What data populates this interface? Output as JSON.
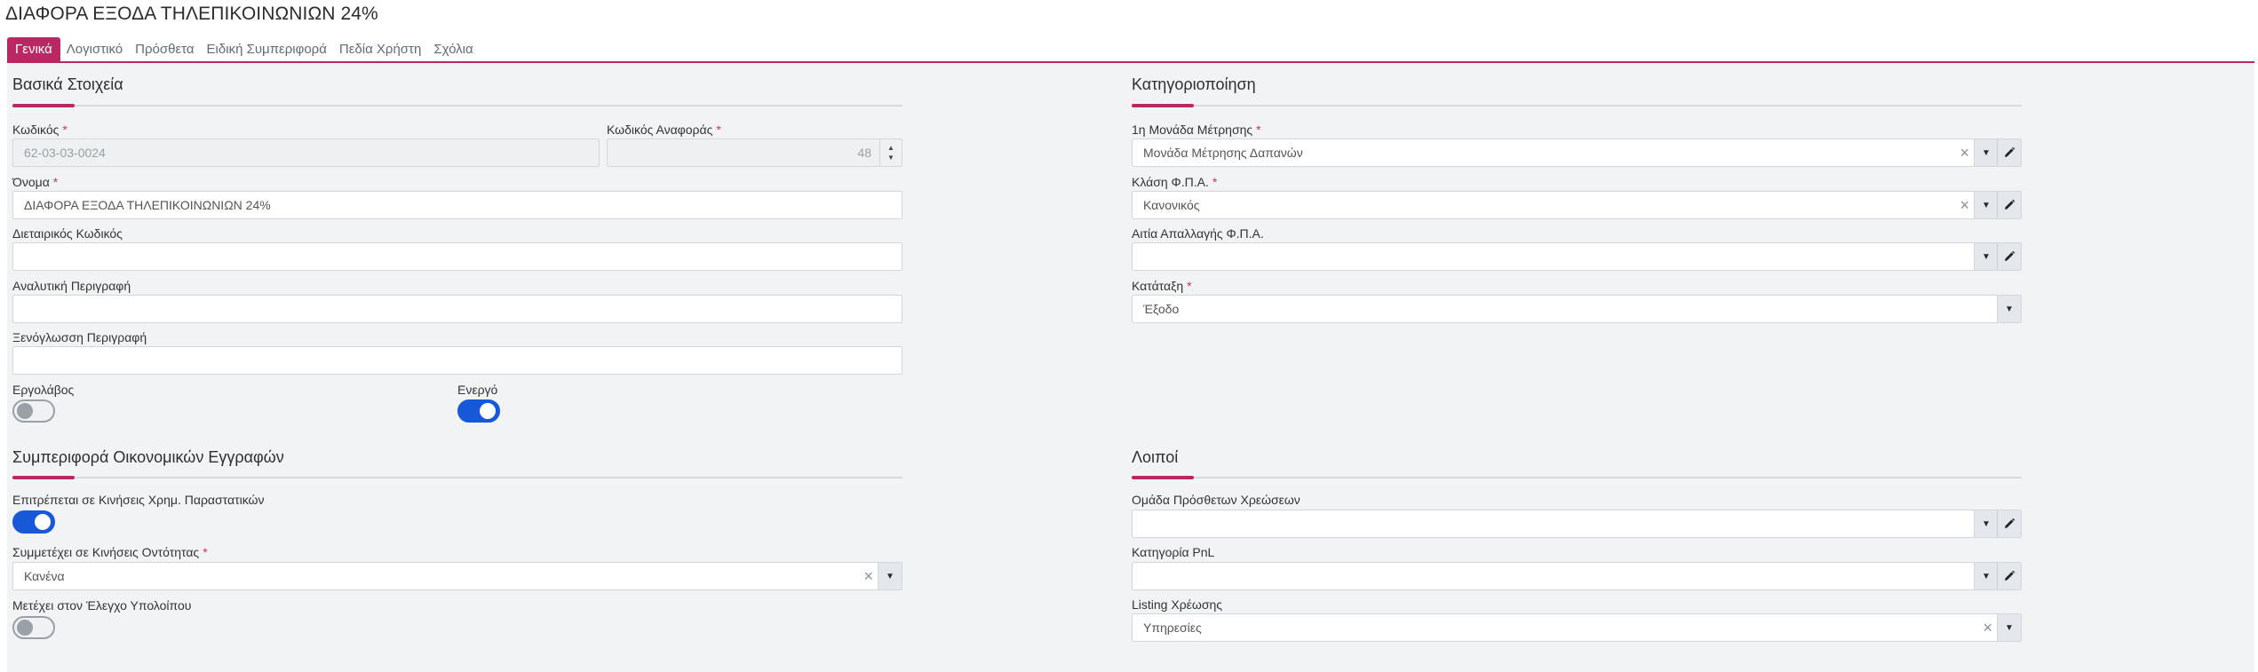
{
  "page": {
    "title": "ΔΙΑΦΟΡΑ ΕΞΟΔΑ ΤΗΛΕΠΙΚΟΙΝΩΝΙΩΝ 24%"
  },
  "tabs": [
    {
      "label": "Γενικά",
      "active": true
    },
    {
      "label": "Λογιστικό",
      "active": false
    },
    {
      "label": "Πρόσθετα",
      "active": false
    },
    {
      "label": "Ειδική Συμπεριφορά",
      "active": false
    },
    {
      "label": "Πεδία Χρήστη",
      "active": false
    },
    {
      "label": "Σχόλια",
      "active": false
    }
  ],
  "colors": {
    "accent": "#b92862",
    "toggle_on": "#1658d8",
    "required": "#d0344d",
    "panel_bg": "#f2f3f5"
  },
  "basic": {
    "title": "Βασικά Στοιχεία",
    "code": {
      "label": "Κωδικός",
      "value": "62-03-03-0024",
      "required": true,
      "disabled": true
    },
    "ref_code": {
      "label": "Κωδικός Αναφοράς",
      "value": "48",
      "required": true,
      "disabled": true
    },
    "name": {
      "label": "Όνομα",
      "value": "ΔΙΑΦΟΡΑ ΕΞΟΔΑ ΤΗΛΕΠΙΚΟΙΝΩΝΙΩΝ 24%",
      "required": true
    },
    "intl_code": {
      "label": "Διεταιρικός Κωδικός",
      "value": ""
    },
    "description": {
      "label": "Αναλυτική Περιγραφή",
      "value": ""
    },
    "foreign_description": {
      "label": "Ξενόγλωσση Περιγραφή",
      "value": ""
    },
    "contractor": {
      "label": "Εργολάβος",
      "on": false
    },
    "active": {
      "label": "Ενεργό",
      "on": true
    }
  },
  "classification": {
    "title": "Κατηγοριοποίηση",
    "unit": {
      "label": "1η Μονάδα Μέτρησης",
      "value": "Μονάδα Μέτρησης Δαπανών",
      "required": true
    },
    "vat_class": {
      "label": "Κλάση Φ.Π.Α.",
      "value": "Κανονικός",
      "required": true
    },
    "vat_exemption": {
      "label": "Αιτία Απαλλαγής Φ.Π.Α.",
      "value": ""
    },
    "category": {
      "label": "Κατάταξη",
      "value": "Έξοδο",
      "required": true
    }
  },
  "financial": {
    "title": "Συμπεριφορά Οικονομικών Εγγραφών",
    "allowed_cash_docs": {
      "label": "Επιτρέπεται σε Κινήσεις Χρημ. Παραστατικών",
      "on": true
    },
    "entity_movements": {
      "label": "Συμμετέχει σε Κινήσεις Οντότητας",
      "value": "Κανένα",
      "required": true
    },
    "balance_check": {
      "label": "Μετέχει στον Έλεγχο Υπολοίπου",
      "on": false
    }
  },
  "other": {
    "title": "Λοιποί",
    "extra_charges_group": {
      "label": "Ομάδα Πρόσθετων Χρεώσεων",
      "value": ""
    },
    "pnl_category": {
      "label": "Κατηγορία PnL",
      "value": ""
    },
    "listing": {
      "label": "Listing Χρέωσης",
      "value": "Υπηρεσίες"
    }
  },
  "icons": {
    "clear": "close-x-icon",
    "dropdown": "caret-down-icon",
    "edit": "pencil-icon",
    "spinner": "up-down-arrows-icon"
  }
}
